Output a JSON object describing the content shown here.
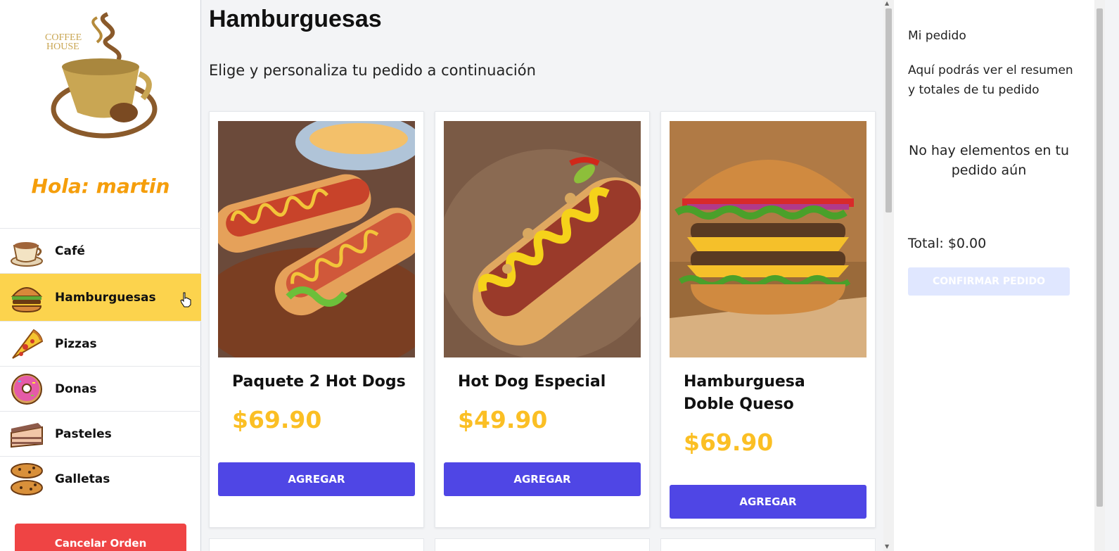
{
  "sidebar": {
    "logo_text_line1": "COFFEE",
    "logo_text_line2": "HOUSE",
    "greeting": "Hola: martin",
    "categories": [
      {
        "label": "Café",
        "icon": "coffee-cup-icon"
      },
      {
        "label": "Hamburguesas",
        "icon": "burger-icon",
        "active": true
      },
      {
        "label": "Pizzas",
        "icon": "pizza-icon"
      },
      {
        "label": "Donas",
        "icon": "donut-icon"
      },
      {
        "label": "Pasteles",
        "icon": "cake-icon"
      },
      {
        "label": "Galletas",
        "icon": "cookie-icon"
      }
    ],
    "cancel_label": "Cancelar Orden"
  },
  "main": {
    "title": "Hamburguesas",
    "subtitle": "Elige y personaliza tu pedido a continuación",
    "products": [
      {
        "name": "Paquete 2 Hot Dogs",
        "price": "$69.90",
        "button": "AGREGAR",
        "image": "two-hotdogs-photo"
      },
      {
        "name": "Hot Dog Especial",
        "price": "$49.90",
        "button": "AGREGAR",
        "image": "special-hotdog-photo"
      },
      {
        "name": "Hamburguesa Doble Queso",
        "price": "$69.90",
        "button": "AGREGAR",
        "image": "double-cheeseburger-photo"
      }
    ]
  },
  "order": {
    "title": "Mi pedido",
    "description": "Aquí podrás ver el resumen y totales de tu pedido",
    "empty_message": "No hay elementos en tu pedido aún",
    "total": "Total: $0.00",
    "confirm_label": "CONFIRMAR PEDIDO"
  },
  "colors": {
    "accent": "#4f46e5",
    "active_category": "#fcd34d",
    "greeting": "#f59e0b",
    "price": "#fbbf24",
    "cancel": "#ef4444"
  }
}
